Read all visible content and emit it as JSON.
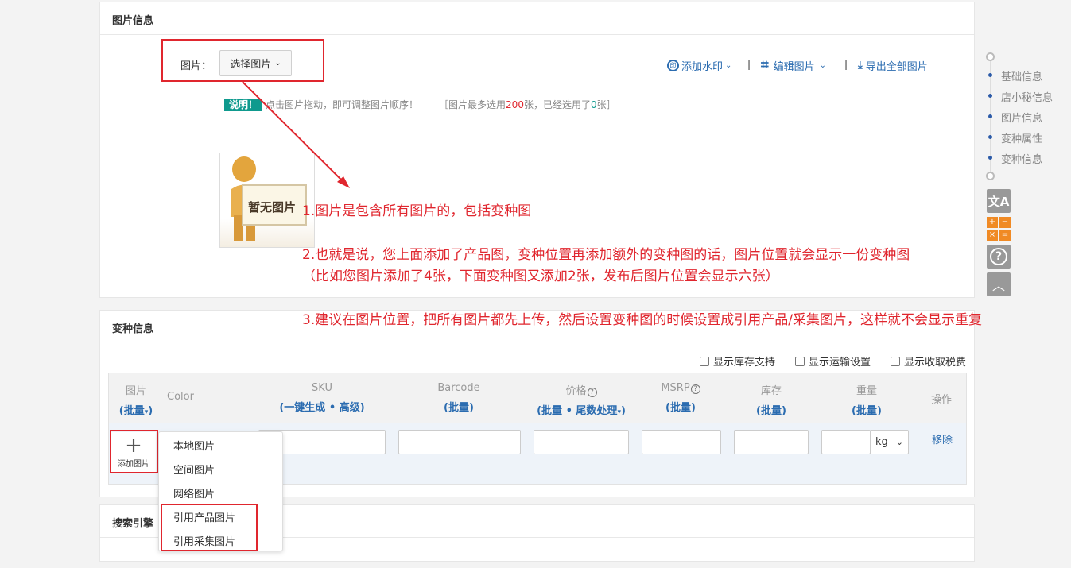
{
  "image_section": {
    "title": "图片信息",
    "field_label": "图片：",
    "select_button": "选择图片",
    "toolbar": {
      "add_watermark": "添加水印",
      "edit_images": "编辑图片",
      "export_all": "导出全部图片",
      "separator": "|"
    },
    "note_badge": "说明！",
    "note_text": "点击图片拖动，即可调整图片顺序！",
    "limit_prefix": "［图片最多选用",
    "limit_max": "200",
    "limit_middle": "张，已经选用了",
    "limit_used": "0",
    "limit_suffix": "张］",
    "placeholder_text": "暂无图片"
  },
  "annotations": {
    "line1": "1.图片是包含所有图片的，包括变种图",
    "line2": "2.也就是说，您上面添加了产品图，变种位置再添加额外的变种图的话，图片位置就会显示一份变种图",
    "line3": "（比如您图片添加了4张，下面变种图又添加2张，发布后图片位置会显示六张）",
    "line4": "3.建议在图片位置，把所有图片都先上传，然后设置变种图的时候设置成引用产品/采集图片，这样就不会显示重复"
  },
  "variant_section": {
    "title": "变种信息",
    "checkboxes": [
      "显示库存支持",
      "显示运输设置",
      "显示收取税费"
    ],
    "headers": {
      "image": "图片",
      "image_sub": "批量",
      "color": "Color",
      "sku": "SKU",
      "sku_sub1": "一键生成",
      "sku_sub2": "高级",
      "barcode": "Barcode",
      "barcode_sub": "批量",
      "price": "价格",
      "price_sub1": "批量",
      "price_sub2": "尾数处理",
      "msrp": "MSRP",
      "msrp_sub": "批量",
      "stock": "库存",
      "stock_sub": "批量",
      "weight": "重量",
      "weight_sub": "批量",
      "action": "操作"
    },
    "add_image_label": "添加图片",
    "weight_unit": "kg",
    "remove_link": "移除"
  },
  "dropdown_menu": {
    "items": [
      "本地图片",
      "空间图片",
      "网络图片",
      "引用产品图片",
      "引用采集图片"
    ]
  },
  "seo_section": {
    "title": "搜索引擎"
  },
  "side_nav": {
    "items": [
      "基础信息",
      "店小秘信息",
      "图片信息",
      "变种属性",
      "变种信息"
    ]
  },
  "colors": {
    "annotation_red": "#e0262e",
    "link_blue": "#2b6cb0",
    "badge_teal": "#0f9a8e"
  }
}
